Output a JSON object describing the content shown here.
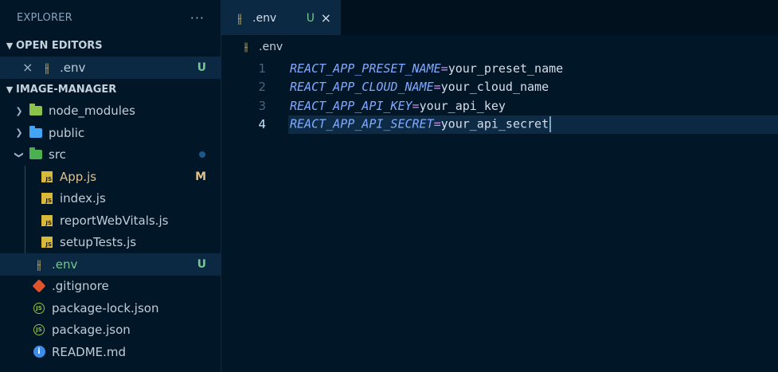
{
  "explorer": {
    "title": "EXPLORER",
    "more": "···",
    "open_editors": {
      "label": "OPEN EDITORS",
      "items": [
        {
          "close": "×",
          "name": ".env",
          "badge": "U",
          "icon": "env-settings-icon"
        }
      ]
    },
    "project": {
      "label": "IMAGE-MANAGER",
      "items": [
        {
          "name": "node_modules",
          "kind": "folder",
          "expanded": false,
          "icon": "node-folder-icon"
        },
        {
          "name": "public",
          "kind": "folder",
          "expanded": false,
          "icon": "public-folder-icon"
        },
        {
          "name": "src",
          "kind": "folder",
          "expanded": true,
          "icon": "src-folder-icon"
        },
        {
          "name": "App.js",
          "badge": "M",
          "icon": "js-icon"
        },
        {
          "name": "index.js",
          "icon": "js-icon"
        },
        {
          "name": "reportWebVitals.js",
          "icon": "js-icon"
        },
        {
          "name": "setupTests.js",
          "icon": "js-icon"
        },
        {
          "name": ".env",
          "badge": "U",
          "icon": "env-settings-icon"
        },
        {
          "name": ".gitignore",
          "icon": "git-icon"
        },
        {
          "name": "package-lock.json",
          "icon": "json-icon"
        },
        {
          "name": "package.json",
          "icon": "json-icon"
        },
        {
          "name": "README.md",
          "icon": "info-icon"
        }
      ]
    }
  },
  "editor": {
    "tab": {
      "label": ".env",
      "badge": "U",
      "close": "×"
    },
    "breadcrumb": ".env",
    "lines": [
      {
        "num": "1",
        "key": "REACT_APP_PRESET_NAME",
        "eq": "=",
        "value": "your_preset_name"
      },
      {
        "num": "2",
        "key": "REACT_APP_CLOUD_NAME",
        "eq": "=",
        "value": "your_cloud_name"
      },
      {
        "num": "3",
        "key": "REACT_APP_API_KEY",
        "eq": "=",
        "value": "your_api_key"
      },
      {
        "num": "4",
        "key": "REACT_APP_API_SECRET",
        "eq": "=",
        "value": "your_api_secret"
      }
    ],
    "current_line": 4
  },
  "colors": {
    "background": "#011627",
    "active_row": "#0b2942",
    "untracked": "#73c991",
    "modified": "#e2c08d",
    "key": "#82aaff",
    "value": "#d6deeb"
  }
}
